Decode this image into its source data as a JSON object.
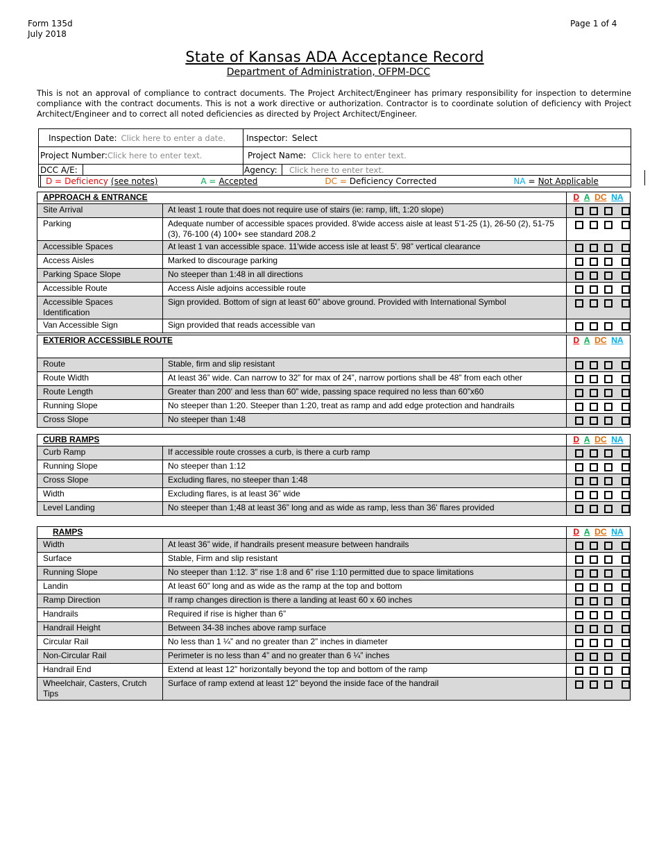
{
  "doc": {
    "form_number": "Form 135d",
    "form_date": "July 2018",
    "page": "Page 1 of 4",
    "title": "State of Kansas ADA Acceptance Record",
    "subtitle": "Department of Administration, OFPM-DCC",
    "disclaimer": "This is not an approval of compliance to contract documents.  The Project Architect/Engineer has primary responsibility for inspection to determine compliance with the contract documents.  This is not a work directive or authorization.  Contractor is to coordinate solution of deficiency with Project Architect/Engineer and to correct all noted deficiencies as directed by Project Architect/Engineer."
  },
  "header": {
    "inspection_date_label": "Inspection Date:",
    "inspection_date_placeholder": "Click here to enter a date.",
    "inspector_label": "Inspector:",
    "inspector_value": "Select",
    "project_number_label": "Project Number:",
    "project_number_placeholder": "Click here to enter text.",
    "project_name_label": "Project Name:",
    "project_name_placeholder": "Click here to enter text.",
    "dcc_ae_label": "DCC  A/E:",
    "dcc_ae_value": "",
    "agency_label": "Agency:",
    "agency_placeholder": "Click here to enter text."
  },
  "legend": {
    "d_code": "D =",
    "d_text": "Deficiency",
    "d_note": "(see notes)",
    "a_code": "A =",
    "a_text": "Accepted",
    "dc_code": "DC =",
    "dc_text": "Deficiency Corrected",
    "na_code": "NA",
    "na_eq": "=",
    "na_text": "Not Applicable"
  },
  "colors": {
    "d": "#ff0000",
    "a": "#00b050",
    "dc": "#e36c0a",
    "na": "#00b0f0",
    "shade": "#d9d9d9"
  },
  "columns": [
    "D",
    "A",
    "DC",
    "NA"
  ],
  "sections": [
    {
      "title": "APPROACH & ENTRANCE",
      "rows": [
        {
          "item": "Site Arrival",
          "requirement": "At least 1 route that does not require use of stairs (ie: ramp, lift, 1:20 slope)"
        },
        {
          "item": "Parking",
          "requirement": "Adequate number of accessible spaces provided. 8'wide access aisle at least 5'1-25 (1), 26-50 (2), 51-75 (3), 76-100 (4) 100+ see standard 208.2"
        },
        {
          "item": "Accessible Spaces",
          "requirement": "At least 1 van accessible space. 11'wide access isle at least 5'. 98” vertical clearance"
        },
        {
          "item": "Access Aisles",
          "requirement": "Marked to discourage parking"
        },
        {
          "item": "Parking Space Slope",
          "requirement": "No steeper than 1:48 in all directions"
        },
        {
          "item": "Accessible Route",
          "requirement": "Access Aisle adjoins accessible route"
        },
        {
          "item": "Accessible Spaces Identification",
          "requirement": "Sign provided. Bottom of sign at least 60” above ground. Provided with International Symbol"
        },
        {
          "item": "Van Accessible Sign",
          "requirement": "Sign provided that reads accessible van"
        }
      ]
    },
    {
      "title": "EXTERIOR ACCESSIBLE ROUTE",
      "rows": [
        {
          "item": "Route",
          "requirement": "Stable, firm and slip resistant"
        },
        {
          "item": "Route Width",
          "requirement": "At least 36” wide. Can narrow to 32” for max of 24”, narrow portions shall be 48” from each other"
        },
        {
          "item": "Route Length",
          "requirement": "Greater than 200' and less than 60” wide, passing space required no less than 60”x60"
        },
        {
          "item": "Running Slope",
          "requirement": "No steeper than 1:20. Steeper than 1:20, treat as ramp and add edge protection and handrails"
        },
        {
          "item": "Cross Slope",
          "requirement": "No steeper than 1:48"
        }
      ]
    },
    {
      "title": "CURB RAMPS",
      "rows": [
        {
          "item": "Curb Ramp",
          "requirement": "If accessible route crosses a curb, is there a curb ramp"
        },
        {
          "item": "Running Slope",
          "requirement": "No steeper than 1:12"
        },
        {
          "item": "Cross Slope",
          "requirement": "Excluding flares, no steeper than 1:48"
        },
        {
          "item": "Width",
          "requirement": "Excluding flares, is at least 36” wide"
        },
        {
          "item": "Level Landing",
          "requirement": "No steeper than 1;48 at least 36” long and as wide as ramp, less than 36' flares provided"
        }
      ]
    },
    {
      "title": "RAMPS",
      "rows": [
        {
          "item": "Width",
          "requirement": "At least 36” wide, if handrails present measure between handrails"
        },
        {
          "item": "Surface",
          "requirement": "Stable, Firm and slip resistant"
        },
        {
          "item": "Running Slope",
          "requirement": "No steeper than 1:12. 3” rise 1:8 and 6” rise 1:10 permitted due to space limitations"
        },
        {
          "item": "Landin",
          "requirement": "At least 60” long and as wide as the ramp at the top and bottom"
        },
        {
          "item": "Ramp Direction",
          "requirement": "If ramp changes direction is there a landing at least 60 x 60 inches"
        },
        {
          "item": "Handrails",
          "requirement": "Required if rise is higher than 6”"
        },
        {
          "item": "Handrail Height",
          "requirement": "Between 34-38 inches above ramp surface"
        },
        {
          "item": "Circular Rail",
          "requirement": "No less than 1 ¼” and no greater than 2” inches in diameter"
        },
        {
          "item": "Non-Circular Rail",
          "requirement": "Perimeter is no less than 4” and no greater than 6 ¼” inches"
        },
        {
          "item": "Handrail End",
          "requirement": "Extend at least 12” horizontally beyond the top and bottom of the ramp"
        },
        {
          "item": "Wheelchair, Casters, Crutch Tips",
          "requirement": "Surface of ramp extend at least 12” beyond the inside face of the handrail"
        }
      ]
    }
  ]
}
